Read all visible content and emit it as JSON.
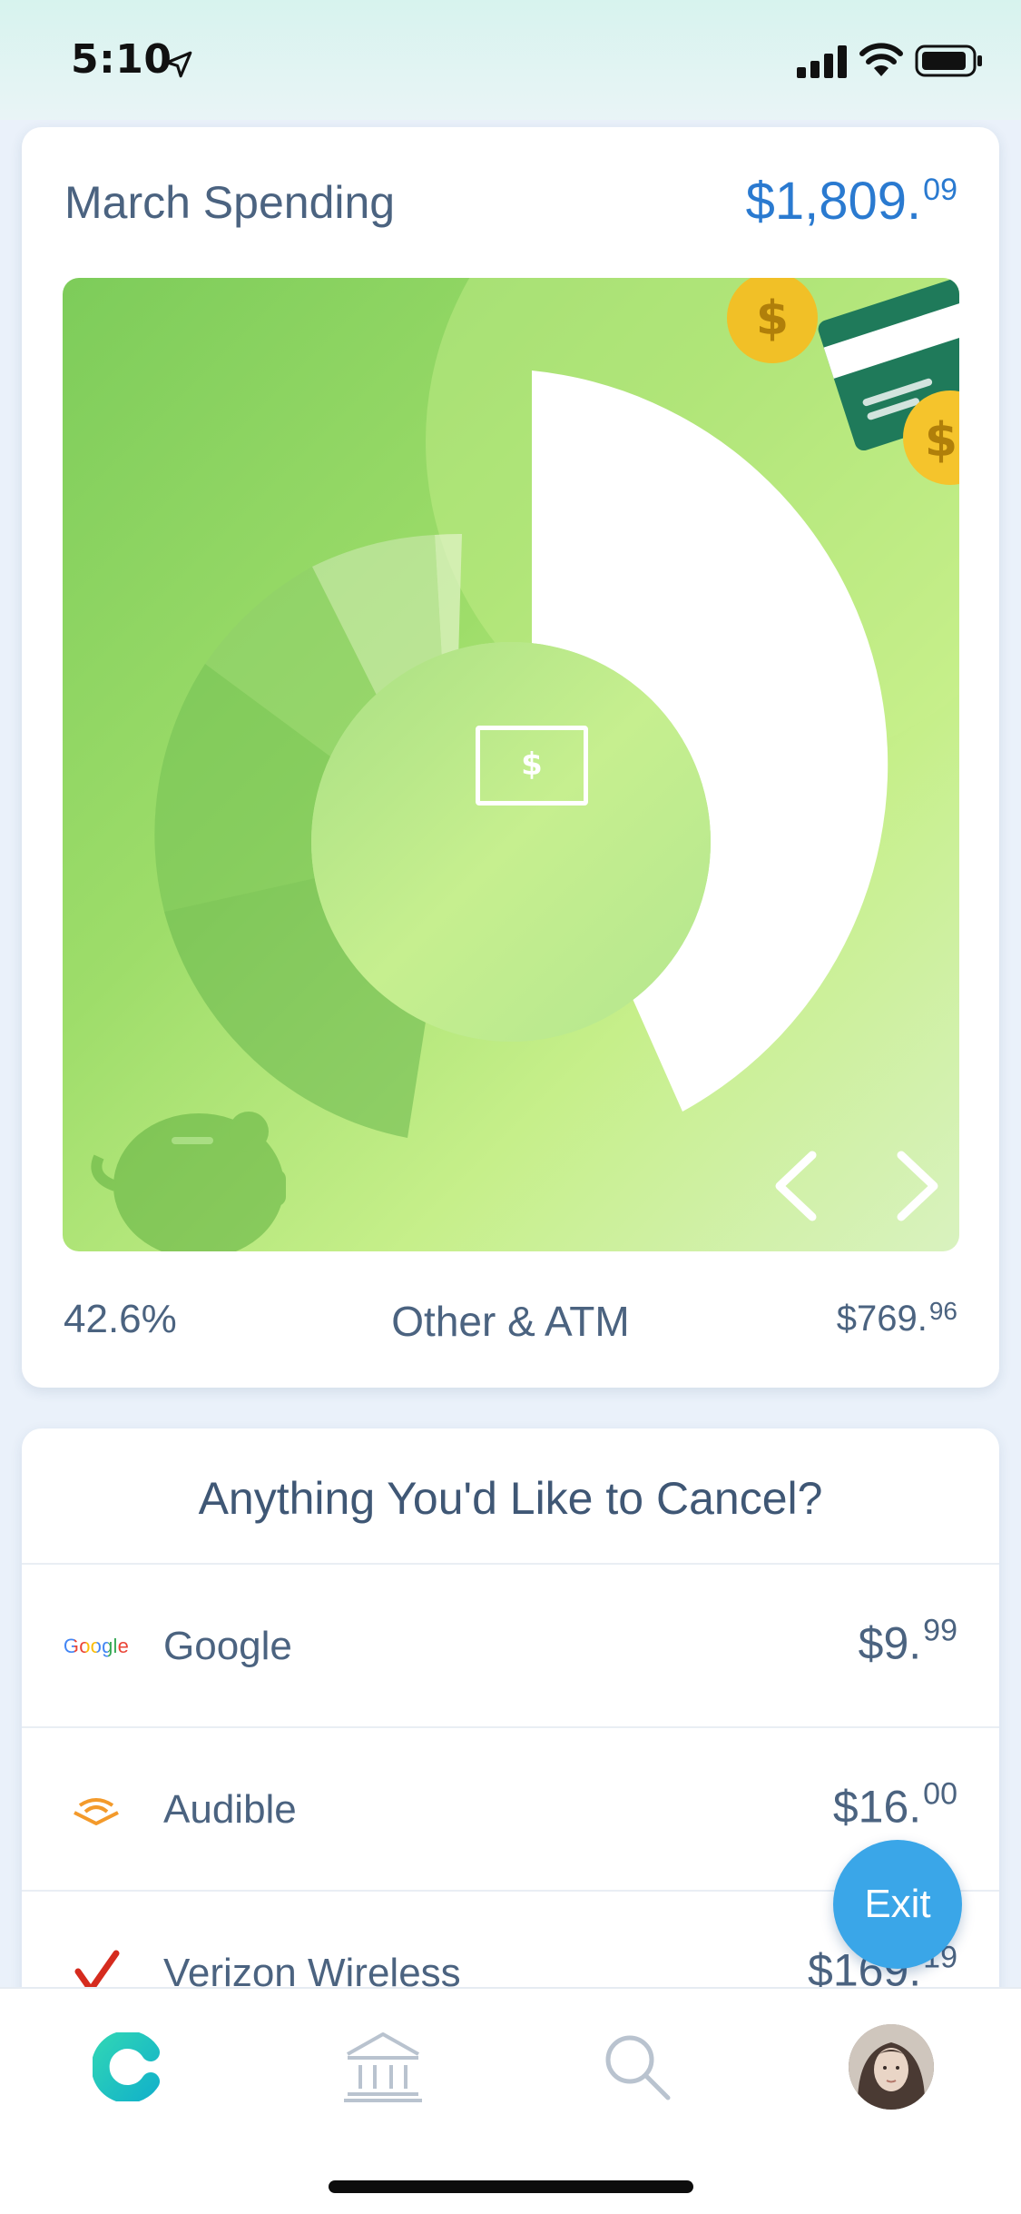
{
  "status_bar": {
    "time": "5:10",
    "icons": [
      "location-arrow-icon",
      "cellular-signal-icon",
      "wifi-icon",
      "battery-icon"
    ]
  },
  "spending_card": {
    "title": "March Spending",
    "total_main": "$1,809.",
    "total_cents": "09",
    "center_icon": "$",
    "selected": {
      "percent": "42.6%",
      "category": "Other & ATM",
      "amount_main": "$769.",
      "amount_cents": "96"
    },
    "donut_share": 0.426,
    "nav": {
      "prev_icon": "chevron-left-icon",
      "next_icon": "chevron-right-icon"
    },
    "colors": {
      "accent": "#2a7ad0",
      "panel": "#9edd6a"
    }
  },
  "cancel_card": {
    "title": "Anything You'd Like to Cancel?",
    "items": [
      {
        "logo_text": "Google",
        "name": "Google",
        "amount_main": "$9.",
        "amount_cents": "99"
      },
      {
        "name": "Audible",
        "amount_main": "$16.",
        "amount_cents": "00"
      },
      {
        "name": "Verizon Wireless",
        "amount_main": "$169.",
        "amount_cents": "19"
      }
    ]
  },
  "exit_button": {
    "label": "Exit",
    "color": "#3aa6e8"
  },
  "tab_bar": {
    "tabs": [
      {
        "id": "home",
        "icon": "clarity-logo-icon"
      },
      {
        "id": "accounts",
        "icon": "bank-icon"
      },
      {
        "id": "search",
        "icon": "search-icon"
      },
      {
        "id": "profile",
        "icon": "avatar"
      }
    ]
  }
}
